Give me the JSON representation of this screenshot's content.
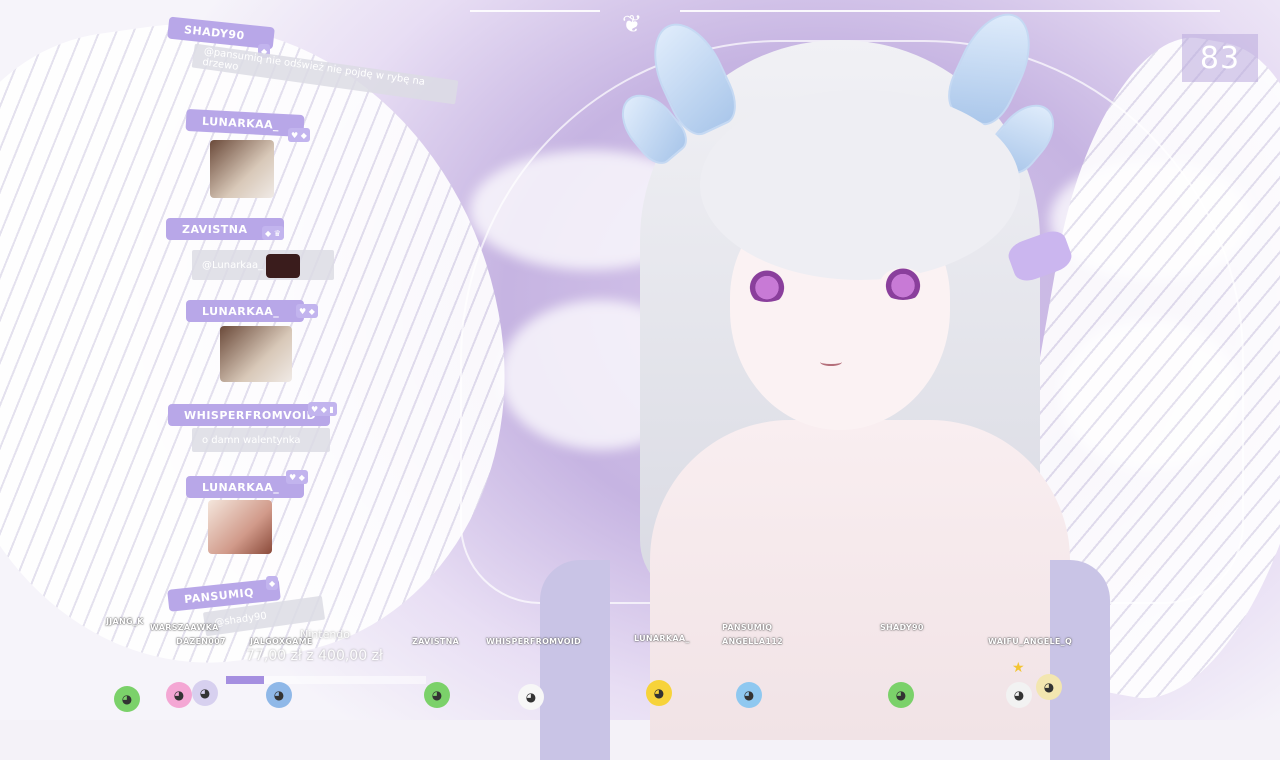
{
  "counter": {
    "value": "83"
  },
  "chat": {
    "messages": [
      {
        "user": "SHADY90",
        "text": "@pansumiq  nie odśwież nie pojdę w rybę na drzewo"
      },
      {
        "user": "LUNARKAA_",
        "text": ""
      },
      {
        "user": "ZAVISTNA",
        "text": "@Lunarkaa_"
      },
      {
        "user": "LUNARKAA_",
        "text": ""
      },
      {
        "user": "WHISPERFROMVOID",
        "text": "o damn  walentynka"
      },
      {
        "user": "LUNARKAA_",
        "text": ""
      },
      {
        "user": "PANSUMIQ",
        "text": "@shady90"
      }
    ]
  },
  "goal": {
    "title": "Nintendo",
    "raised": "77,00 zł",
    "separator": "z",
    "target": "400,00 zł",
    "fraction": 0.19
  },
  "viewers": [
    {
      "name": "JJANG_K"
    },
    {
      "name": "WARSZAAWKA"
    },
    {
      "name": "DAZEN007"
    },
    {
      "name": "JALGOXGAME"
    },
    {
      "name": "ZAVISTNA"
    },
    {
      "name": "WHISPERFROMVOID"
    },
    {
      "name": "LUNARKAA_"
    },
    {
      "name": "PANSUMIQ"
    },
    {
      "name": "ANGELLA112"
    },
    {
      "name": "SHADY90"
    },
    {
      "name": "WAIFU_ANGELE_Q"
    }
  ],
  "colors": {
    "accent": "#b8a7e8",
    "sky": "#c6b4e2",
    "horn": "#a9c6ea"
  },
  "icons": {
    "top": "butterfly-icon",
    "goal_star": "star-icon"
  }
}
